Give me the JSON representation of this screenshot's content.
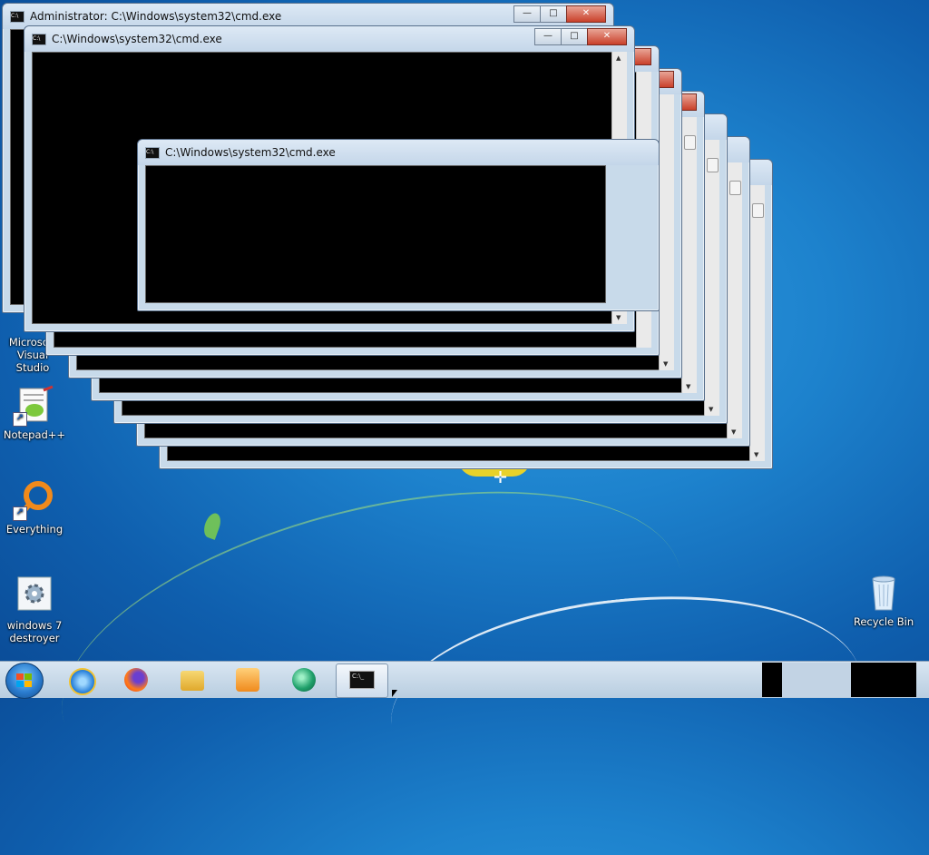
{
  "desktop": {
    "icons": [
      {
        "label": "Microsoft Visual Studio",
        "icon": "visual-studio-icon"
      },
      {
        "label": "Notepad++",
        "icon": "notepad-plus-plus-icon"
      },
      {
        "label": "Everything",
        "icon": "everything-search-icon"
      },
      {
        "label": "windows 7 destroyer",
        "icon": "settings-gear-icon"
      },
      {
        "label": "Recycle Bin",
        "icon": "recycle-bin-icon"
      }
    ]
  },
  "windows": {
    "admin_title": "Administrator: C:\\Windows\\system32\\cmd.exe",
    "cmd_title": "C:\\Windows\\system32\\cmd.exe",
    "minimize": "—",
    "maximize": "□",
    "close": "✕"
  },
  "taskbar": {
    "items": [
      {
        "icon": "internet-explorer-icon"
      },
      {
        "icon": "firefox-icon"
      },
      {
        "icon": "file-explorer-icon"
      },
      {
        "icon": "media-player-icon"
      },
      {
        "icon": "app-icon"
      },
      {
        "icon": "cmd-icon",
        "label": "C:\\_"
      }
    ]
  },
  "colors": {
    "desktop_blue": "#1d82cd",
    "console_bg": "#000000",
    "close_red": "#c9402a"
  }
}
